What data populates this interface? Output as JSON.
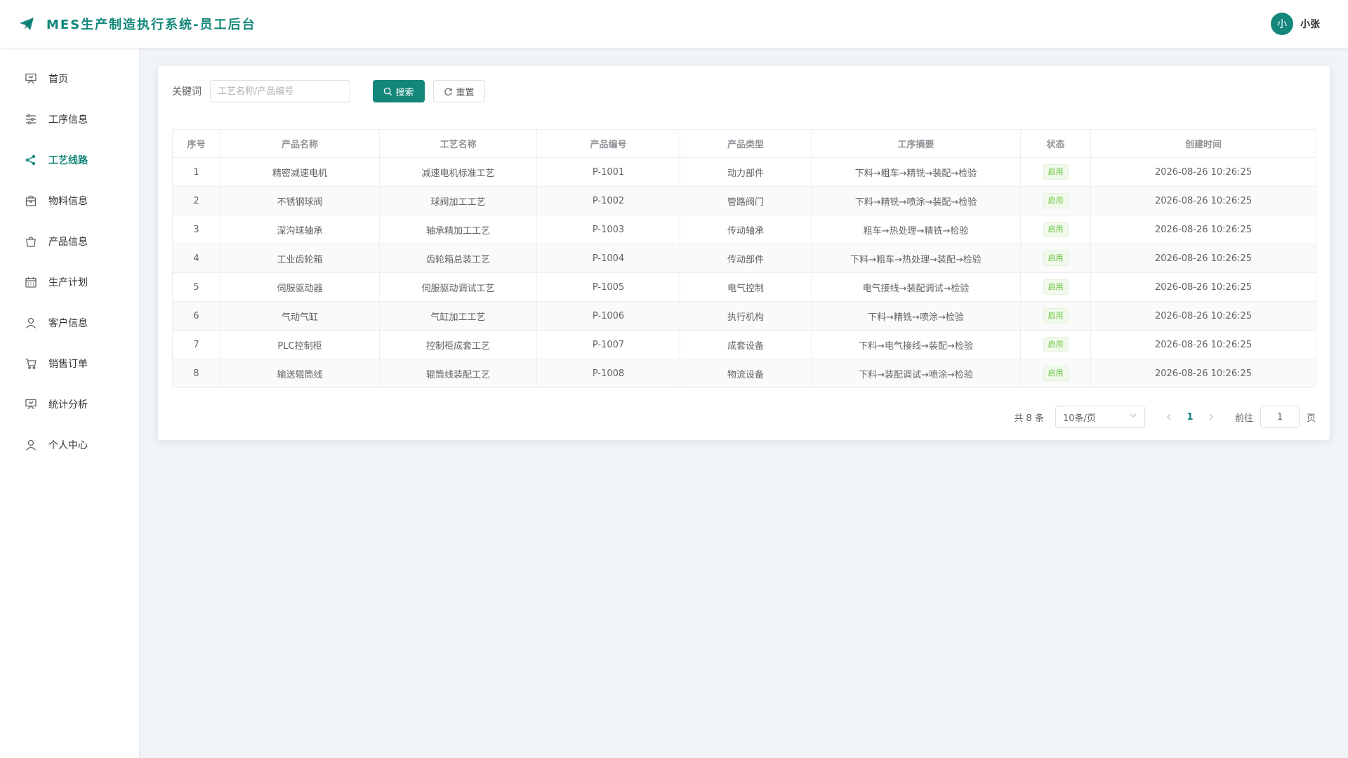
{
  "header": {
    "title": "MES生产制造执行系统-员工后台",
    "avatar_text": "小",
    "user_name": "小张",
    "accent_color": "#13877a"
  },
  "sidebar": {
    "items": [
      {
        "label": "首页",
        "icon": "presentation-board-icon",
        "active": false
      },
      {
        "label": "工序信息",
        "icon": "sliders-icon",
        "active": false
      },
      {
        "label": "工艺线路",
        "icon": "share-icon",
        "active": true
      },
      {
        "label": "物料信息",
        "icon": "bag-icon",
        "active": false
      },
      {
        "label": "产品信息",
        "icon": "shopping-bag-icon",
        "active": false
      },
      {
        "label": "生产计划",
        "icon": "calendar-icon",
        "active": false
      },
      {
        "label": "客户信息",
        "icon": "user-icon",
        "active": false
      },
      {
        "label": "销售订单",
        "icon": "cart-icon",
        "active": false
      },
      {
        "label": "统计分析",
        "icon": "presentation-board-icon",
        "active": false
      },
      {
        "label": "个人中心",
        "icon": "user-icon",
        "active": false
      }
    ]
  },
  "search": {
    "label": "关键词",
    "placeholder": "工艺名称/产品编号",
    "value": "",
    "search_button": "搜索",
    "reset_button": "重置"
  },
  "table": {
    "columns": [
      "序号",
      "产品名称",
      "工艺名称",
      "产品编号",
      "产品类型",
      "工序摘要",
      "状态",
      "创建时间"
    ],
    "rows": [
      [
        "1",
        "精密减速电机",
        "减速电机标准工艺",
        "P-1001",
        "动力部件",
        "下料→粗车→精铣→装配→检验",
        "启用",
        "2026-08-26 10:26:25"
      ],
      [
        "2",
        "不锈钢球阀",
        "球阀加工工艺",
        "P-1002",
        "管路阀门",
        "下料→精铣→喷涂→装配→检验",
        "启用",
        "2026-08-26 10:26:25"
      ],
      [
        "3",
        "深沟球轴承",
        "轴承精加工工艺",
        "P-1003",
        "传动轴承",
        "粗车→热处理→精铣→检验",
        "启用",
        "2026-08-26 10:26:25"
      ],
      [
        "4",
        "工业齿轮箱",
        "齿轮箱总装工艺",
        "P-1004",
        "传动部件",
        "下料→粗车→热处理→装配→检验",
        "启用",
        "2026-08-26 10:26:25"
      ],
      [
        "5",
        "伺服驱动器",
        "伺服驱动调试工艺",
        "P-1005",
        "电气控制",
        "电气接线→装配调试→检验",
        "启用",
        "2026-08-26 10:26:25"
      ],
      [
        "6",
        "气动气缸",
        "气缸加工工艺",
        "P-1006",
        "执行机构",
        "下料→精铣→喷涂→检验",
        "启用",
        "2026-08-26 10:26:25"
      ],
      [
        "7",
        "PLC控制柜",
        "控制柜成套工艺",
        "P-1007",
        "成套设备",
        "下料→电气接线→装配→检验",
        "启用",
        "2026-08-26 10:26:25"
      ],
      [
        "8",
        "输送辊筒线",
        "辊筒线装配工艺",
        "P-1008",
        "物流设备",
        "下料→装配调试→喷涂→检验",
        "启用",
        "2026-08-26 10:26:25"
      ]
    ]
  },
  "pager": {
    "total": "共 8 条",
    "page_size": "10条/页",
    "current_page": "1",
    "goto_label": "前往",
    "goto_value": "1",
    "page_suffix": "页"
  }
}
